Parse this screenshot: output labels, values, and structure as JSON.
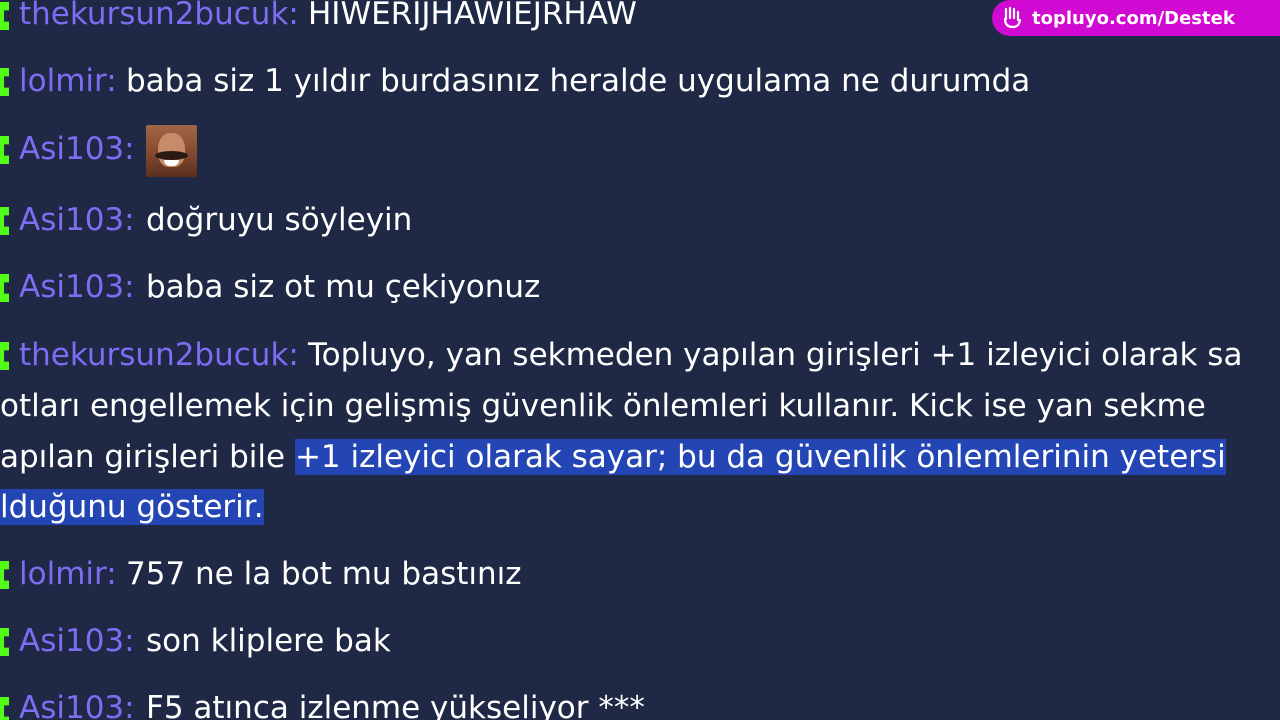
{
  "support_link": {
    "icon": "hand-icon",
    "text": "topluyo.com/Destek",
    "color": "#d10ad3"
  },
  "colors": {
    "background": "#1f2845",
    "username": "#7c6df2",
    "badge": "#53fc18",
    "highlight": "#2446b4"
  },
  "messages": [
    {
      "user": "thekursun2bucuk",
      "sep": ":",
      "text": "HIWERIJHAWIEJRHAW"
    },
    {
      "user": "lolmir",
      "sep": ":",
      "text": "baba siz 1 yıldır burdasınız heralde uygulama ne durumda"
    },
    {
      "user": "Asi103",
      "sep": ":",
      "text": "",
      "emote": "laughing-man-emote"
    },
    {
      "user": "Asi103",
      "sep": ":",
      "text": "doğruyu söyleyin"
    },
    {
      "user": "Asi103",
      "sep": ":",
      "text": "baba siz ot mu çekiyonuz"
    },
    {
      "user": "thekursun2bucuk",
      "sep": ":",
      "lines": [
        "Topluyo, yan sekmeden yapılan girişleri +1 izleyici olarak sa",
        "otları engellemek için gelişmiş güvenlik önlemleri kullanır. Kick ise yan sekme",
        "apılan girişleri bile ",
        "+1 izleyici olarak sayar; bu da güvenlik önlemlerinin yetersi",
        "lduğunu gösterir."
      ]
    },
    {
      "user": "lolmir",
      "sep": ":",
      "text": "757 ne la bot mu bastınız"
    },
    {
      "user": "Asi103",
      "sep": ":",
      "text": "son kliplere bak"
    },
    {
      "user": "Asi103",
      "sep": ":",
      "text": "F5 atınca izlenme yükseliyor ***"
    }
  ]
}
